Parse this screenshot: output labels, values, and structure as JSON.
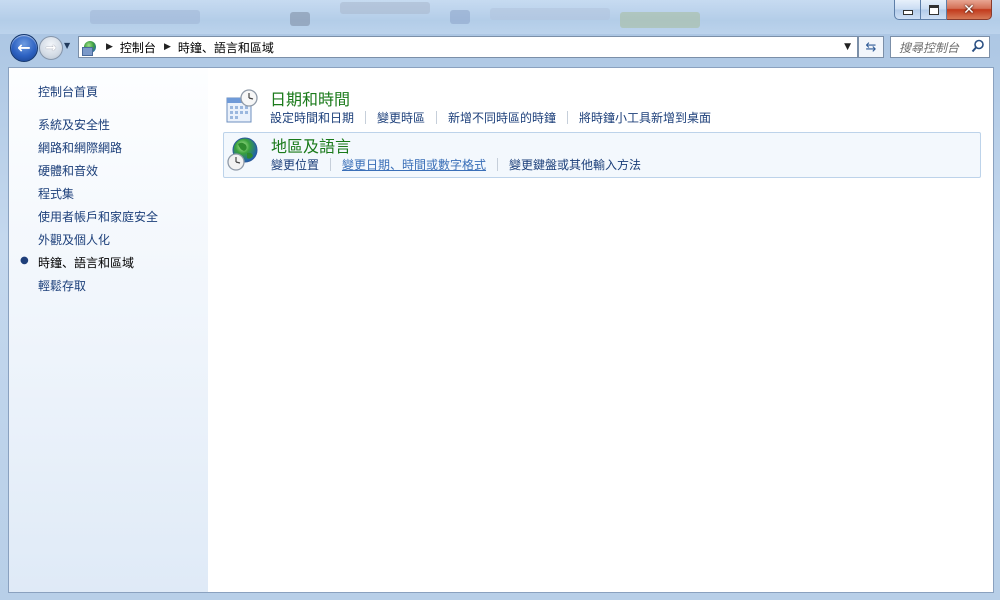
{
  "window": {
    "caption_buttons": {
      "minimize_icon": "minimize-icon",
      "maximize_icon": "maximize-icon",
      "close_icon": "close-icon"
    }
  },
  "nav": {
    "back_glyph": "←",
    "forward_glyph": "→",
    "breadcrumb": [
      "控制台",
      "時鐘、語言和區域"
    ],
    "search_placeholder": "搜尋控制台"
  },
  "sidebar": {
    "home_label": "控制台首頁",
    "items": [
      {
        "label": "系統及安全性",
        "current": false
      },
      {
        "label": "網路和網際網路",
        "current": false
      },
      {
        "label": "硬體和音效",
        "current": false
      },
      {
        "label": "程式集",
        "current": false
      },
      {
        "label": "使用者帳戶和家庭安全",
        "current": false
      },
      {
        "label": "外觀及個人化",
        "current": false
      },
      {
        "label": "時鐘、語言和區域",
        "current": true
      },
      {
        "label": "輕鬆存取",
        "current": false
      }
    ]
  },
  "categories": [
    {
      "title": "日期和時間",
      "icon": "calendar-clock-icon",
      "tasks": [
        "設定時間和日期",
        "變更時區",
        "新增不同時區的時鐘",
        "將時鐘小工具新增到桌面"
      ]
    },
    {
      "title": "地區及語言",
      "icon": "globe-clock-icon",
      "tasks": [
        "變更位置",
        "變更日期、時間或數字格式",
        "變更鍵盤或其他輸入方法"
      ]
    }
  ],
  "colors": {
    "category_title": "#1a7a1a",
    "link": "#1c3f7a",
    "hover_link": "#3a6fb8",
    "accent_back": "#2d62c2"
  }
}
